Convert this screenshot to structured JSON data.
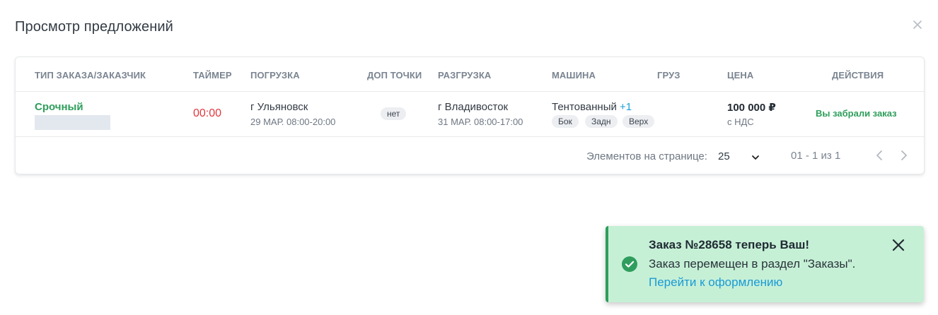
{
  "dialog": {
    "title": "Просмотр предложений",
    "close_icon": "close-icon"
  },
  "table": {
    "headers": {
      "type": "ТИП ЗАКАЗА/ЗАКАЗЧИК",
      "timer": "ТАЙМЕР",
      "loading": "ПОГРУЗКА",
      "extra_points": "ДОП ТОЧКИ",
      "unloading": "РАЗГРУЗКА",
      "vehicle": "МАШИНА",
      "cargo": "ГРУЗ",
      "price": "ЦЕНА",
      "actions": "ДЕЙСТВИЯ"
    },
    "rows": [
      {
        "order_type": "Срочный",
        "timer": "00:00",
        "loading_city": "г Ульяновск",
        "loading_datetime": "29 МАР. 08:00-20:00",
        "extra_points": "нет",
        "unloading_city": "г Владивосток",
        "unloading_datetime": "31 МАР. 08:00-17:00",
        "vehicle_type": "Тентованный",
        "vehicle_more": "+1",
        "loading_types": [
          "Бок",
          "Задн",
          "Верх"
        ],
        "price": "100 000 ₽",
        "vat": "с НДС",
        "action_status": "Вы забрали заказ"
      }
    ]
  },
  "pagination": {
    "items_per_page_label": "Элементов на странице:",
    "items_per_page_value": "25",
    "range": "01 - 1 из 1"
  },
  "toast": {
    "title": "Заказ №28658 теперь Ваш!",
    "text": "Заказ перемещен в раздел \"Заказы\".",
    "link": "Перейти к оформлению",
    "icon": "check-circle-icon",
    "color": "#2f9d5d",
    "background": "#c6f0d6"
  },
  "colors": {
    "urgent": "#2e9e5b",
    "timer": "#e0383e",
    "link": "#1a9ad6"
  }
}
